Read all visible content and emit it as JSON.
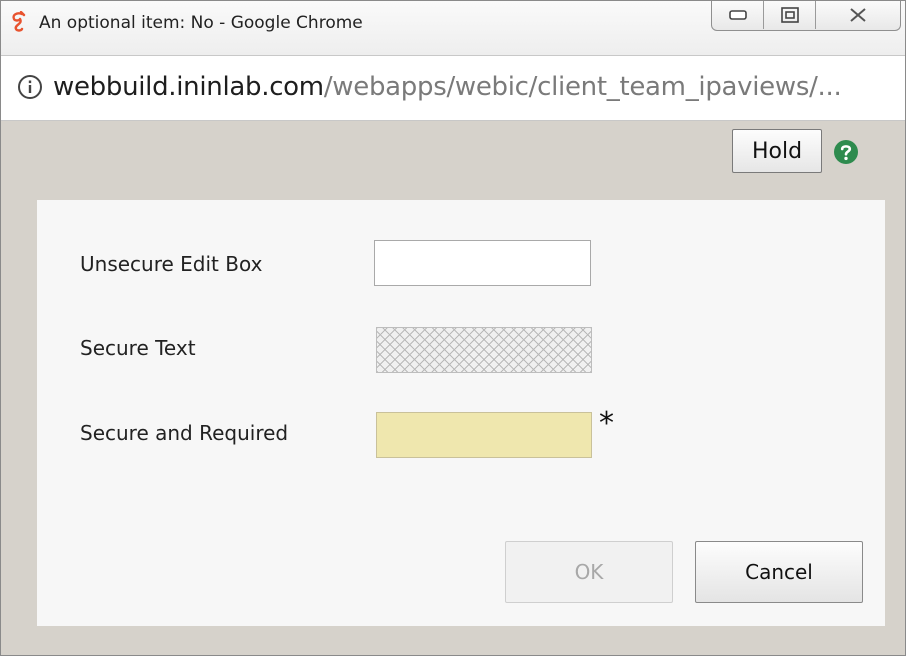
{
  "window": {
    "title": "An optional item: No - Google Chrome",
    "controls": [
      "minimize-icon",
      "maximize-icon",
      "close-icon"
    ]
  },
  "address": {
    "host": "webbuild.ininlab.com",
    "path": "/webapps/webic/client_team_ipaviews/..."
  },
  "toolbar": {
    "hold_label": "Hold"
  },
  "form": {
    "fields": [
      {
        "label": "Unsecure Edit Box",
        "value": ""
      },
      {
        "label": "Secure Text",
        "value": ""
      },
      {
        "label": "Secure and Required",
        "value": "",
        "required_marker": "*"
      }
    ]
  },
  "buttons": {
    "ok_label": "OK",
    "cancel_label": "Cancel"
  },
  "colors": {
    "app_icon": "#e8532f",
    "help_icon": "#2e8b4e",
    "required_bg": "#efe7ae"
  }
}
